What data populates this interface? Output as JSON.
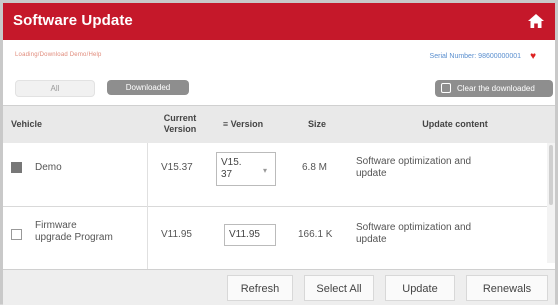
{
  "header": {
    "title": "Software Update",
    "home_icon": "home-icon",
    "accent_color": "#c5182a"
  },
  "info": {
    "hint": "Loading/Download Demo/Help",
    "serial": "Serial Number: 98600000001",
    "heart_icon": "heart-icon"
  },
  "tabs": {
    "all_label": "All",
    "downloaded_label": "Downloaded"
  },
  "clear_button": {
    "label": "Clear the downloaded"
  },
  "table": {
    "headers": {
      "vehicle": "Vehicle",
      "current_version_line1": "Current",
      "current_version_line2": "Version",
      "version": "Version",
      "size": "Size",
      "update_content": "Update content"
    },
    "rows": [
      {
        "checked": true,
        "vehicle": "Demo",
        "current_version": "V15.37",
        "version_line1": "V15.",
        "version_line2": "37",
        "size": "6.8 M",
        "content_line1": "Software optimization and",
        "content_line2": "update"
      },
      {
        "checked": false,
        "vehicle_line1": "Firmware",
        "vehicle_line2": "upgrade Program",
        "current_version": "V11.95",
        "version": "V11.95",
        "size": "166.1 K",
        "content_line1": "Software optimization and",
        "content_line2": "update"
      }
    ]
  },
  "footer": {
    "refresh": "Refresh",
    "select_all": "Select All",
    "update": "Update",
    "renewals": "Renewals"
  }
}
